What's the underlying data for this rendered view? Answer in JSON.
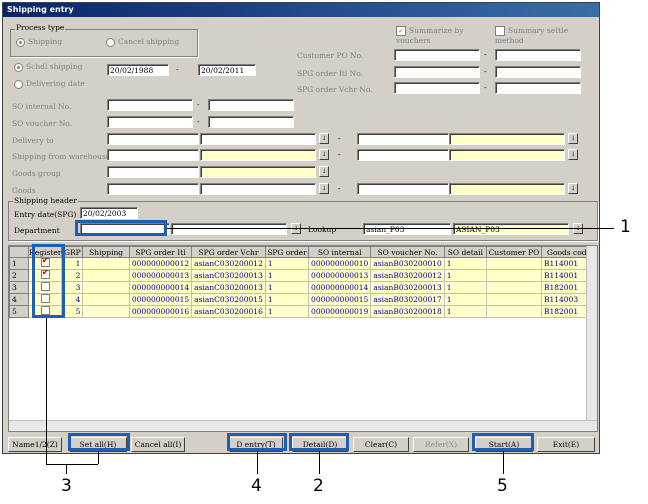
{
  "window": {
    "title": "Shipping entry"
  },
  "process_type": {
    "label": "Process type",
    "shipping": "Shipping",
    "cancel_shipping": "Cancel shipping",
    "schd_shipping": "Schdl shipping",
    "delivering_date": "Delivering date",
    "date_from": "20/02/1988",
    "date_to": "20/02/2011"
  },
  "options": {
    "summarize_by_vouchers": "Summarize by vouchers",
    "summary_settle_method": "Summary settle method"
  },
  "labels": {
    "customer_po_no": "Customer PO No.",
    "spg_order_itl_no": "SPG order Itl No.",
    "spg_order_vchr_no": "SPG order Vchr No.",
    "so_internal_no": "SO internal No.",
    "so_voucher_no": "SO voucher No.",
    "delivery_to": "Delivery to",
    "shipping_from_warehouse": "Shipping from warehouse",
    "goods_group": "Goods group",
    "goods": "Goods",
    "range_sep": "-",
    "spin": "↓"
  },
  "header": {
    "label": "Shipping header",
    "entry_date_label": "Entry date(SPG)",
    "entry_date": "20/02/2003",
    "department_label": "Department",
    "lookup_label": "Lookup",
    "lookup_code": "asian_P03",
    "lookup_name": "ASIAN_P03"
  },
  "grid": {
    "columns": [
      "",
      "Register",
      "GRP",
      "Shipping",
      "SPG order Itl",
      "SPG order Vchr",
      "SPG order",
      "SO internal",
      "SO voucher No.",
      "SO detail",
      "Customer PO",
      "Goods code"
    ],
    "rows": [
      {
        "n": "1",
        "reg": true,
        "grp": "1",
        "ship": "",
        "itl": "000000000012",
        "vchr": "asianC030200012",
        "ord": "1",
        "soi": "000000000010",
        "sov": "asianB030200010",
        "sod": "1",
        "cpo": "",
        "goods": "B114001"
      },
      {
        "n": "2",
        "reg": true,
        "grp": "2",
        "ship": "",
        "itl": "000000000013",
        "vchr": "asianC030200013",
        "ord": "1",
        "soi": "000000000013",
        "sov": "asianB030200012",
        "sod": "1",
        "cpo": "",
        "goods": "B114001"
      },
      {
        "n": "3",
        "reg": false,
        "grp": "3",
        "ship": "",
        "itl": "000000000014",
        "vchr": "asianC030200013",
        "ord": "1",
        "soi": "000000000014",
        "sov": "asianB030200013",
        "sod": "1",
        "cpo": "",
        "goods": "B182001"
      },
      {
        "n": "4",
        "reg": false,
        "grp": "4",
        "ship": "",
        "itl": "000000000015",
        "vchr": "asianC030200015",
        "ord": "1",
        "soi": "000000000015",
        "sov": "asianB030200017",
        "sod": "1",
        "cpo": "",
        "goods": "B114003"
      },
      {
        "n": "5",
        "reg": false,
        "grp": "5",
        "ship": "",
        "itl": "000000000016",
        "vchr": "asianC030200016",
        "ord": "1",
        "soi": "000000000019",
        "sov": "asianB030200018",
        "sod": "1",
        "cpo": "",
        "goods": "B182001"
      }
    ]
  },
  "buttons": {
    "name": "Name1/2(Z)",
    "set_all": "Set all(H)",
    "cancel_all": "Cancel all(I)",
    "d_entry": "D entry(T)",
    "detail": "Detail(D)",
    "clear": "Clear(C)",
    "refer": "Refer(X)",
    "start": "Start(A)",
    "exit": "Exit(E)"
  },
  "callouts": [
    "1",
    "2",
    "3",
    "4",
    "5"
  ],
  "colors": {
    "highlight": "#1e5fb4",
    "titlebar": "#0a246a",
    "row_fill": "#ffffc8"
  }
}
